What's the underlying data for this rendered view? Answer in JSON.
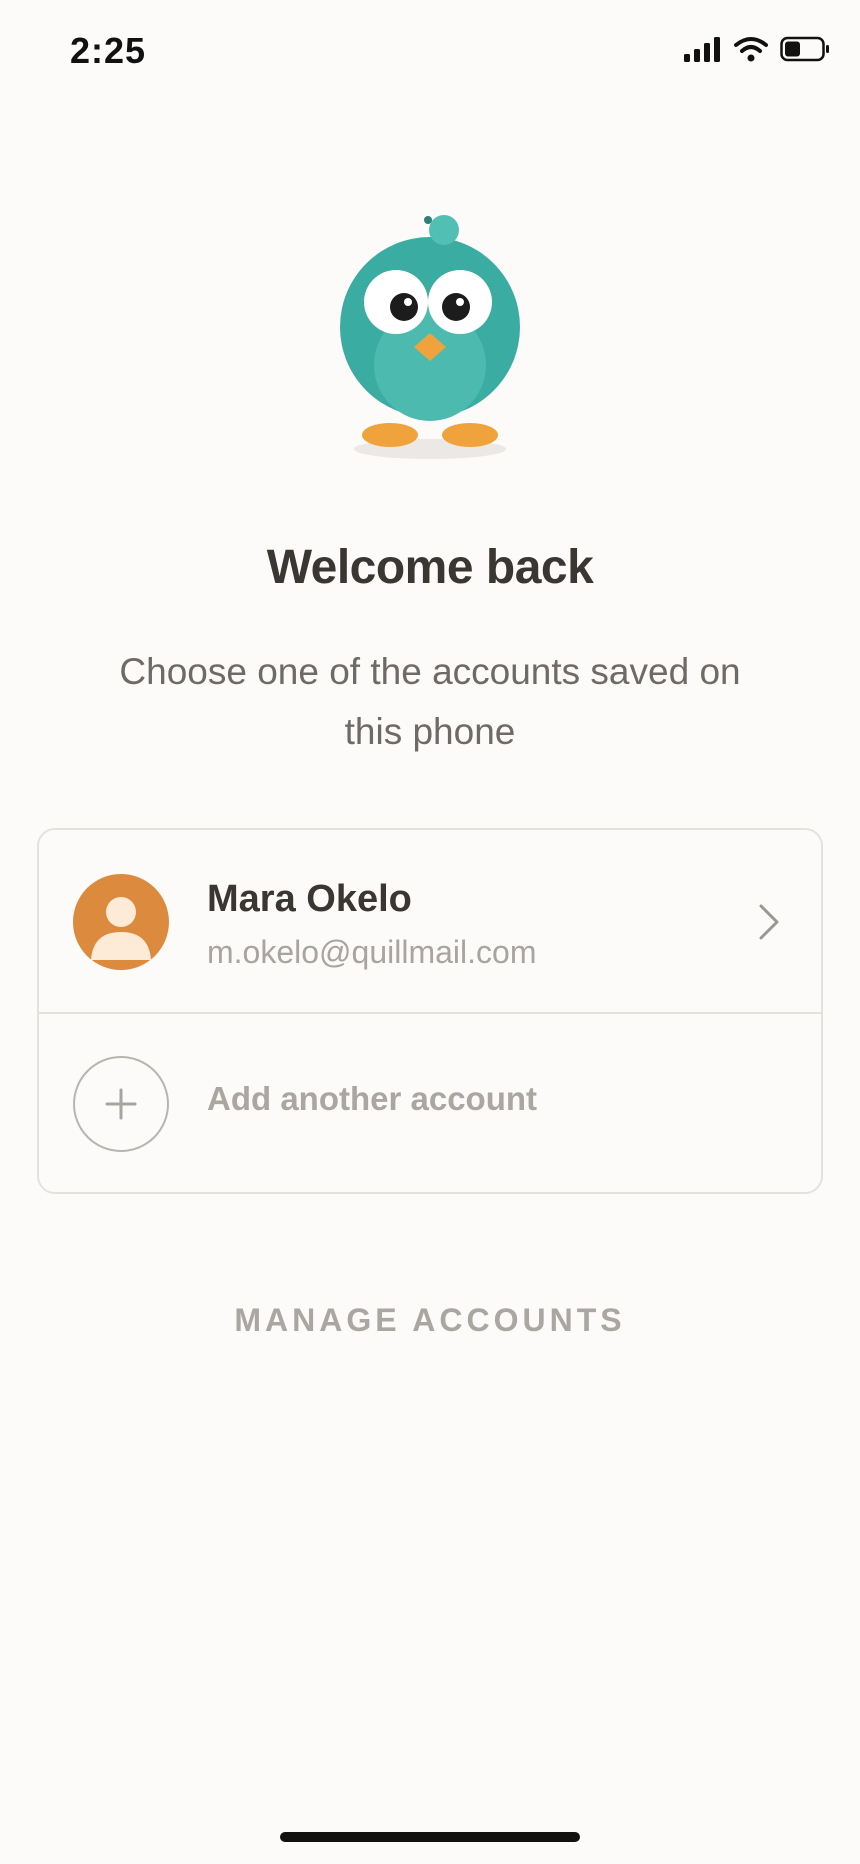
{
  "status_bar": {
    "time": "2:25",
    "icons": [
      "signal-icon",
      "wifi-icon",
      "battery-icon"
    ]
  },
  "welcome": {
    "title": "Welcome back",
    "subtitle": "Choose one of the accounts saved on this phone"
  },
  "accounts": [
    {
      "name": "Mara Okelo",
      "email": "m.okelo@quillmail.com",
      "avatar_color": "#dc8b3e"
    }
  ],
  "add_account": {
    "label": "Add another account"
  },
  "manage": {
    "label": "MANAGE ACCOUNTS"
  },
  "colors": {
    "background": "#fcfbfa",
    "mascot_body": "#3aaca2",
    "mascot_feet": "#f0a33c",
    "text_primary": "#3a3733",
    "text_muted": "#aaa6a2"
  }
}
